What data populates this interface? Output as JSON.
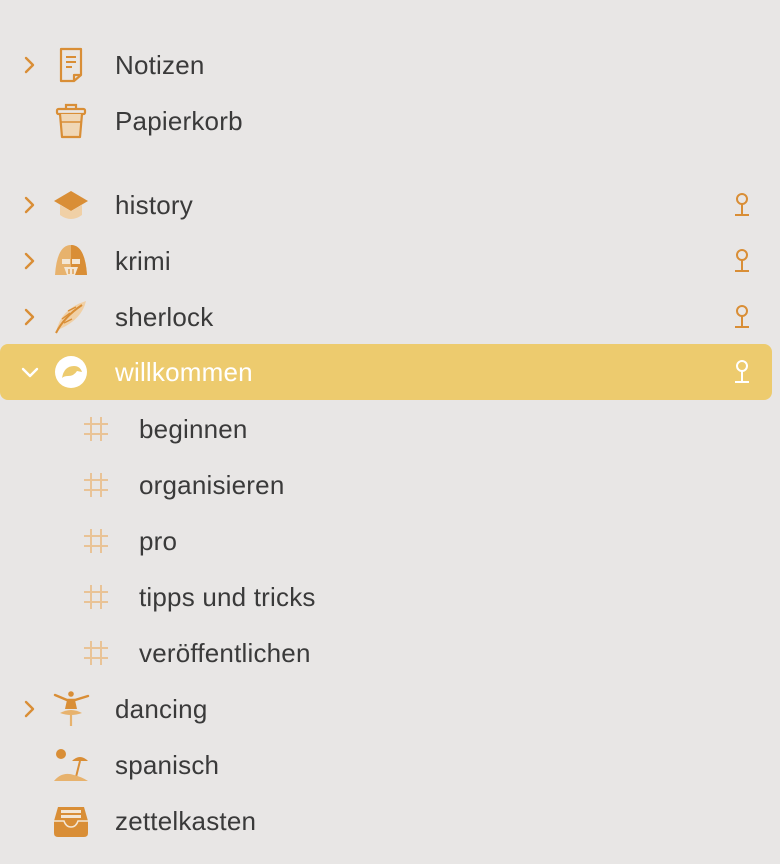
{
  "colors": {
    "accent": "#d98e36",
    "selected_bg": "#edcb6e",
    "background": "#e8e6e5",
    "text": "#3a3a3a"
  },
  "items": {
    "notizen": {
      "label": "Notizen",
      "icon": "note-icon"
    },
    "papierkorb": {
      "label": "Papierkorb",
      "icon": "trash-icon"
    },
    "history": {
      "label": "history",
      "icon": "graduation-cap-icon"
    },
    "krimi": {
      "label": "krimi",
      "icon": "helmet-icon"
    },
    "sherlock": {
      "label": "sherlock",
      "icon": "feather-icon"
    },
    "willkommen": {
      "label": "willkommen",
      "icon": "bird-icon",
      "expanded": true,
      "selected": true
    },
    "dancing": {
      "label": "dancing",
      "icon": "dancer-icon"
    },
    "spanisch": {
      "label": "spanisch",
      "icon": "beach-icon"
    },
    "zettelkasten": {
      "label": "zettelkasten",
      "icon": "inbox-tray-icon"
    }
  },
  "children": [
    {
      "label": "beginnen"
    },
    {
      "label": "organisieren"
    },
    {
      "label": "pro"
    },
    {
      "label": "tipps und tricks"
    },
    {
      "label": "veröffentlichen"
    }
  ]
}
